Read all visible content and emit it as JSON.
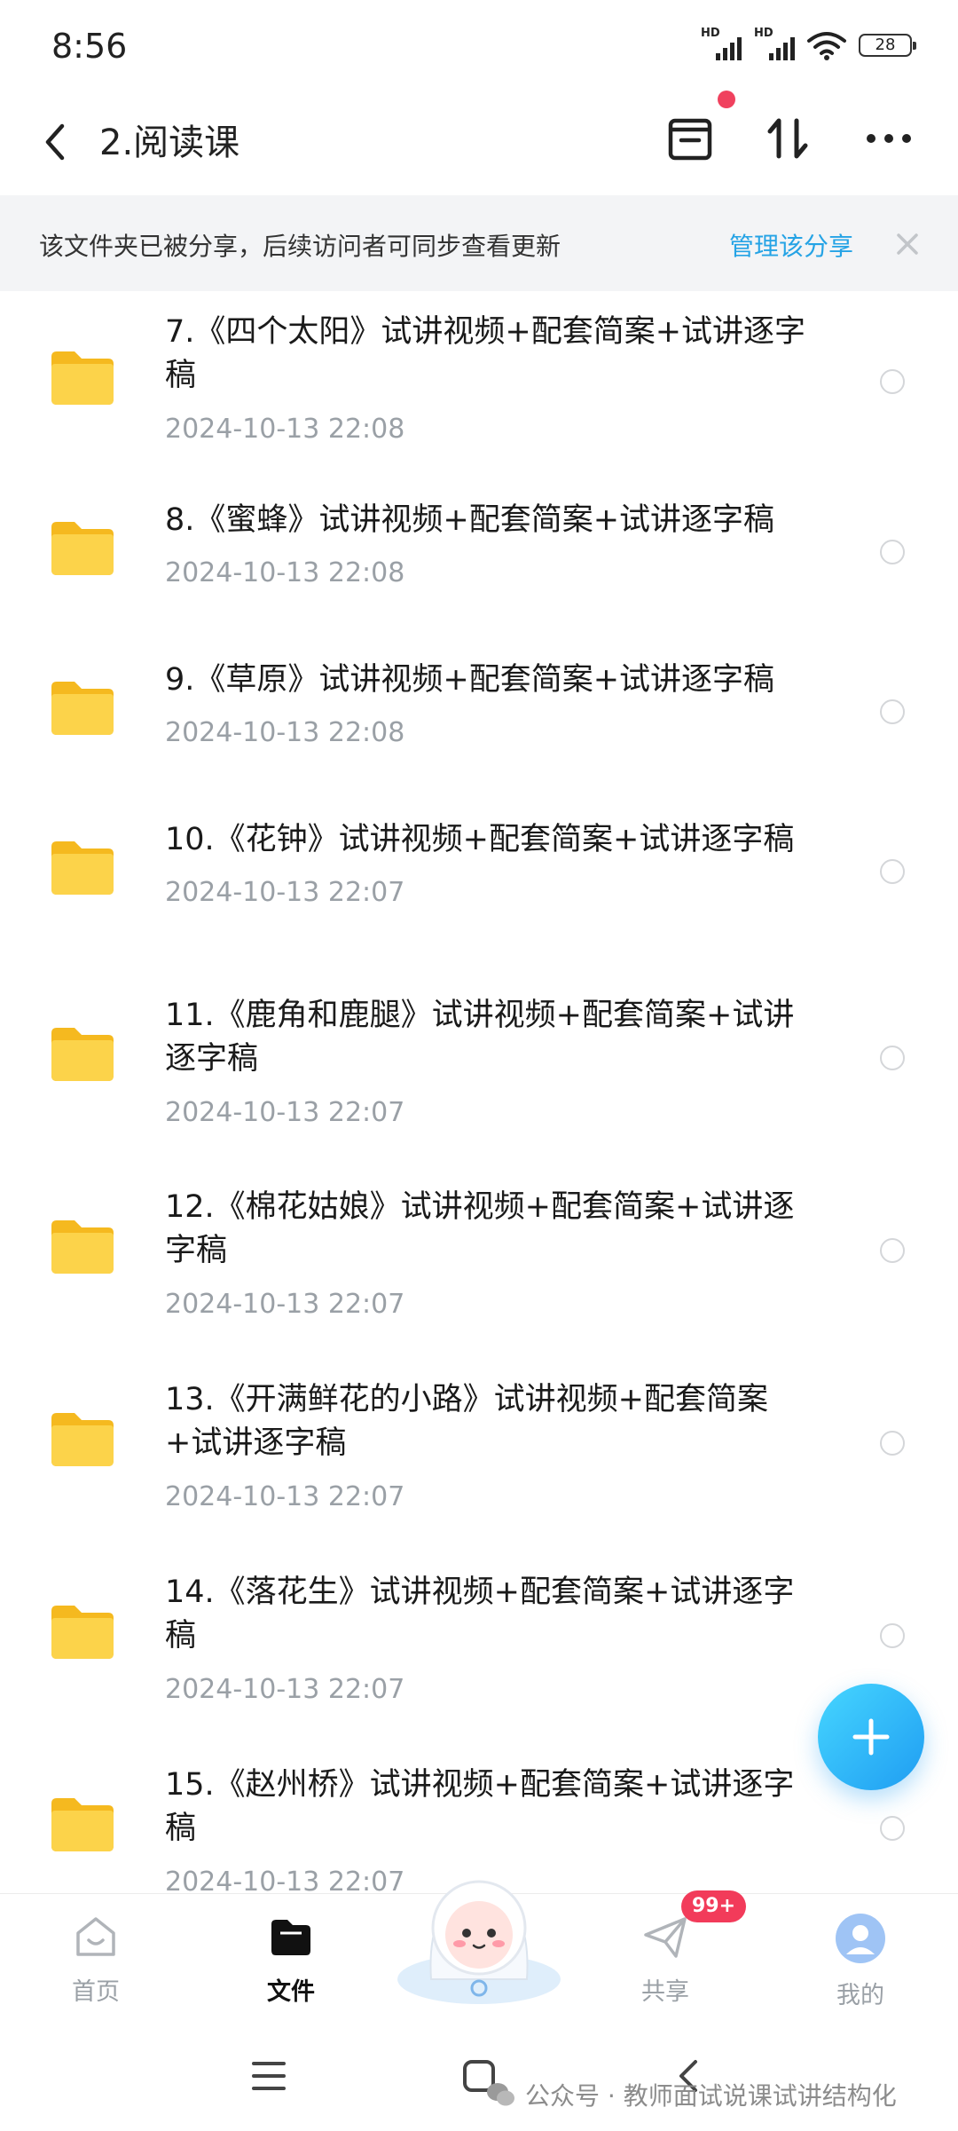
{
  "status_bar": {
    "time": "8:56",
    "signal_label": "HD",
    "battery": "28"
  },
  "header": {
    "title": "2.阅读课",
    "back_icon": "chevron-left-icon"
  },
  "banner": {
    "text": "该文件夹已被分享，后续访问者可同步查看更新",
    "link": "管理该分享"
  },
  "files": [
    {
      "name": "7.《四个太阳》试讲视频+配套简案+试讲逐字稿",
      "line1": "7.《四个太阳》试讲视频+配套简案+试讲逐字",
      "line2": "稿",
      "date": "2024-10-13  22:08"
    },
    {
      "name": "8.《蜜蜂》试讲视频+配套简案+试讲逐字稿",
      "line1": "8.《蜜蜂》试讲视频+配套简案+试讲逐字稿",
      "line2": "",
      "date": "2024-10-13  22:08"
    },
    {
      "name": "9.《草原》试讲视频+配套简案+试讲逐字稿",
      "line1": "9.《草原》试讲视频+配套简案+试讲逐字稿",
      "line2": "",
      "date": "2024-10-13  22:08"
    },
    {
      "name": "10.《花钟》试讲视频+配套简案+试讲逐字稿",
      "line1": "10.《花钟》试讲视频+配套简案+试讲逐字稿",
      "line2": "",
      "date": "2024-10-13  22:07"
    },
    {
      "name": "11.《鹿角和鹿腿》试讲视频+配套简案+试讲逐字稿",
      "line1": "11.《鹿角和鹿腿》试讲视频+配套简案+试讲",
      "line2": "逐字稿",
      "date": "2024-10-13  22:07"
    },
    {
      "name": "12.《棉花姑娘》试讲视频+配套简案+试讲逐字稿",
      "line1": "12.《棉花姑娘》试讲视频+配套简案+试讲逐",
      "line2": "字稿",
      "date": "2024-10-13  22:07"
    },
    {
      "name": "13.《开满鲜花的小路》试讲视频+配套简案+试讲逐字稿",
      "line1": "13.《开满鲜花的小路》试讲视频+配套简案",
      "line2": "+试讲逐字稿",
      "date": "2024-10-13  22:07"
    },
    {
      "name": "14.《落花生》试讲视频+配套简案+试讲逐字稿",
      "line1": "14.《落花生》试讲视频+配套简案+试讲逐字",
      "line2": "稿",
      "date": "2024-10-13  22:07"
    },
    {
      "name": "15.《赵州桥》试讲视频+配套简案+试讲逐字稿",
      "line1": "15.《赵州桥》试讲视频+配套简案+试讲逐字",
      "line2": "稿",
      "date": "2024-10-13  22:07"
    }
  ],
  "bottom_nav": {
    "items": [
      {
        "label": "首页",
        "icon": "home-icon"
      },
      {
        "label": "文件",
        "icon": "folder-icon",
        "active": true
      },
      {
        "label": "",
        "icon": "mascot-icon"
      },
      {
        "label": "共享",
        "icon": "send-icon",
        "badge": "99+"
      },
      {
        "label": "我的",
        "icon": "avatar-icon"
      }
    ]
  },
  "watermark": "公众号 · 教师面试说课试讲结构化",
  "colors": {
    "accent": "#25a3e5",
    "badge": "#f23b5a",
    "folder": "#f9c62d"
  }
}
